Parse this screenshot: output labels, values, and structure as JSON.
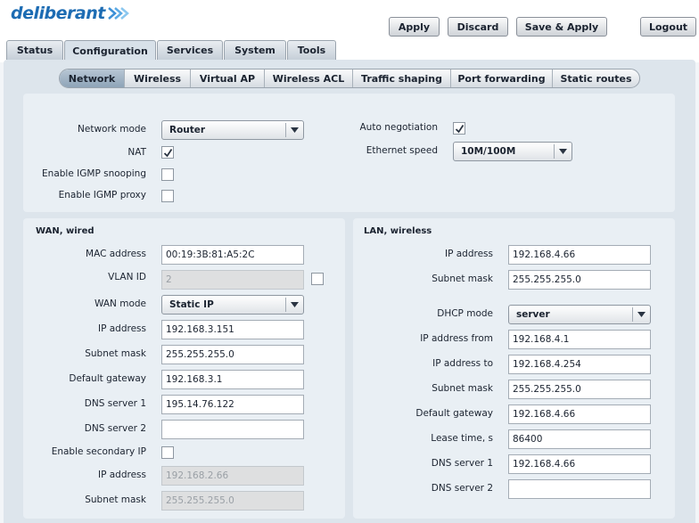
{
  "brand": {
    "name": "deliberant"
  },
  "colors": {
    "brand": "#1d6cb3",
    "background": "#dde5ec",
    "panel": "#e9eff4"
  },
  "header_buttons": [
    {
      "label": "Apply"
    },
    {
      "label": "Discard"
    },
    {
      "label": "Save & Apply"
    },
    {
      "label": "Logout"
    }
  ],
  "main_tabs": [
    {
      "label": "Status"
    },
    {
      "label": "Configuration"
    },
    {
      "label": "Services"
    },
    {
      "label": "System"
    },
    {
      "label": "Tools"
    }
  ],
  "active_main_tab": "Configuration",
  "sub_tabs": [
    {
      "label": "Network"
    },
    {
      "label": "Wireless"
    },
    {
      "label": "Virtual AP"
    },
    {
      "label": "Wireless ACL"
    },
    {
      "label": "Traffic shaping"
    },
    {
      "label": "Port forwarding"
    },
    {
      "label": "Static routes"
    }
  ],
  "active_sub_tab": "Network",
  "general": {
    "network_mode": {
      "label": "Network mode",
      "value": "Router"
    },
    "nat": {
      "label": "NAT",
      "checked": true
    },
    "igmp_snooping": {
      "label": "Enable IGMP snooping",
      "checked": false
    },
    "igmp_proxy": {
      "label": "Enable IGMP proxy",
      "checked": false
    },
    "auto_negotiation": {
      "label": "Auto negotiation",
      "checked": true
    },
    "ethernet_speed": {
      "label": "Ethernet speed",
      "value": "10M/100M"
    }
  },
  "wan": {
    "title": "WAN, wired",
    "mac_address": {
      "label": "MAC address",
      "value": "00:19:3B:81:A5:2C"
    },
    "vlan_id": {
      "label": "VLAN ID",
      "value": "2",
      "checked": false
    },
    "wan_mode": {
      "label": "WAN mode",
      "value": "Static IP"
    },
    "ip_address": {
      "label": "IP address",
      "value": "192.168.3.151"
    },
    "subnet_mask": {
      "label": "Subnet mask",
      "value": "255.255.255.0"
    },
    "default_gateway": {
      "label": "Default gateway",
      "value": "192.168.3.1"
    },
    "dns_server_1": {
      "label": "DNS server 1",
      "value": "195.14.76.122"
    },
    "dns_server_2": {
      "label": "DNS server 2",
      "value": ""
    },
    "secondary_ip": {
      "label": "Enable secondary IP",
      "checked": false
    },
    "secondary_ip_address": {
      "label": "IP address",
      "value": "192.168.2.66"
    },
    "secondary_subnet_mask": {
      "label": "Subnet mask",
      "value": "255.255.255.0"
    }
  },
  "lan": {
    "title": "LAN, wireless",
    "ip_address": {
      "label": "IP address",
      "value": "192.168.4.66"
    },
    "subnet_mask": {
      "label": "Subnet mask",
      "value": "255.255.255.0"
    },
    "dhcp_mode": {
      "label": "DHCP mode",
      "value": "server"
    },
    "ip_from": {
      "label": "IP address from",
      "value": "192.168.4.1"
    },
    "ip_to": {
      "label": "IP address to",
      "value": "192.168.4.254"
    },
    "dhcp_subnet_mask": {
      "label": "Subnet mask",
      "value": "255.255.255.0"
    },
    "default_gateway": {
      "label": "Default gateway",
      "value": "192.168.4.66"
    },
    "lease_time": {
      "label": "Lease time, s",
      "value": "86400"
    },
    "dns_server_1": {
      "label": "DNS server 1",
      "value": "192.168.4.66"
    },
    "dns_server_2": {
      "label": "DNS server 2",
      "value": ""
    }
  }
}
